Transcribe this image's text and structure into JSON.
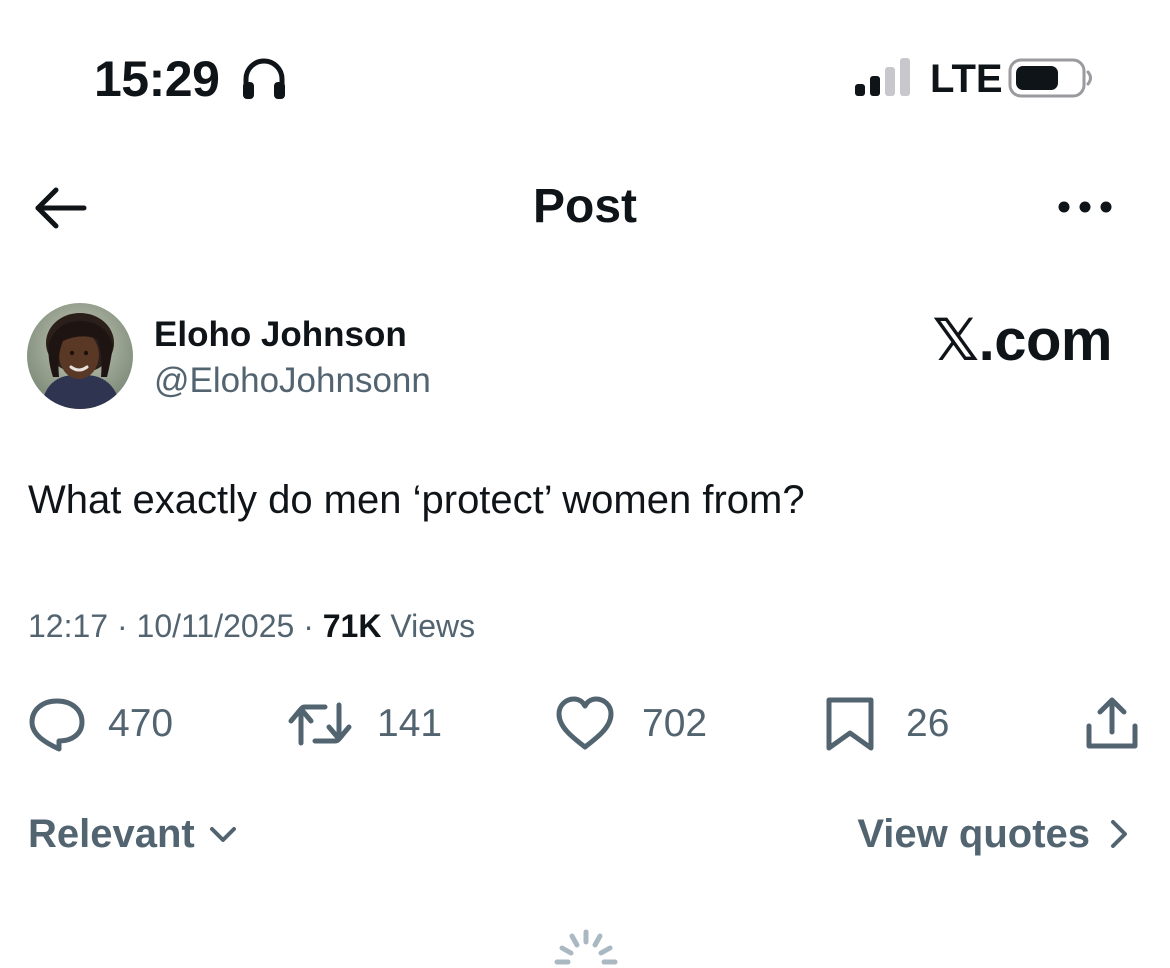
{
  "status_bar": {
    "time": "15:29",
    "network": "LTE",
    "icons": [
      "headphones-icon",
      "cellular-signal-icon",
      "battery-icon"
    ]
  },
  "header": {
    "title": "Post",
    "back_icon": "arrow-left-icon",
    "more_icon": "more-dots-icon"
  },
  "post": {
    "author": {
      "display_name": "Eloho Johnson",
      "handle": "@ElohoJohnsonn"
    },
    "watermark": "𝕏.com",
    "text": "What exactly do men ‘protect’ women from?",
    "meta": {
      "time": "12:17",
      "separator": " · ",
      "date": "10/11/2025",
      "views_count": "71K",
      "views_label": " Views"
    },
    "actions": {
      "replies": "470",
      "reposts": "141",
      "likes": "702",
      "bookmarks": "26"
    }
  },
  "replies_bar": {
    "sort_label": "Relevant",
    "view_quotes_label": "View quotes"
  },
  "colors": {
    "text": "#0f1419",
    "secondary": "#536471",
    "background": "#ffffff"
  }
}
